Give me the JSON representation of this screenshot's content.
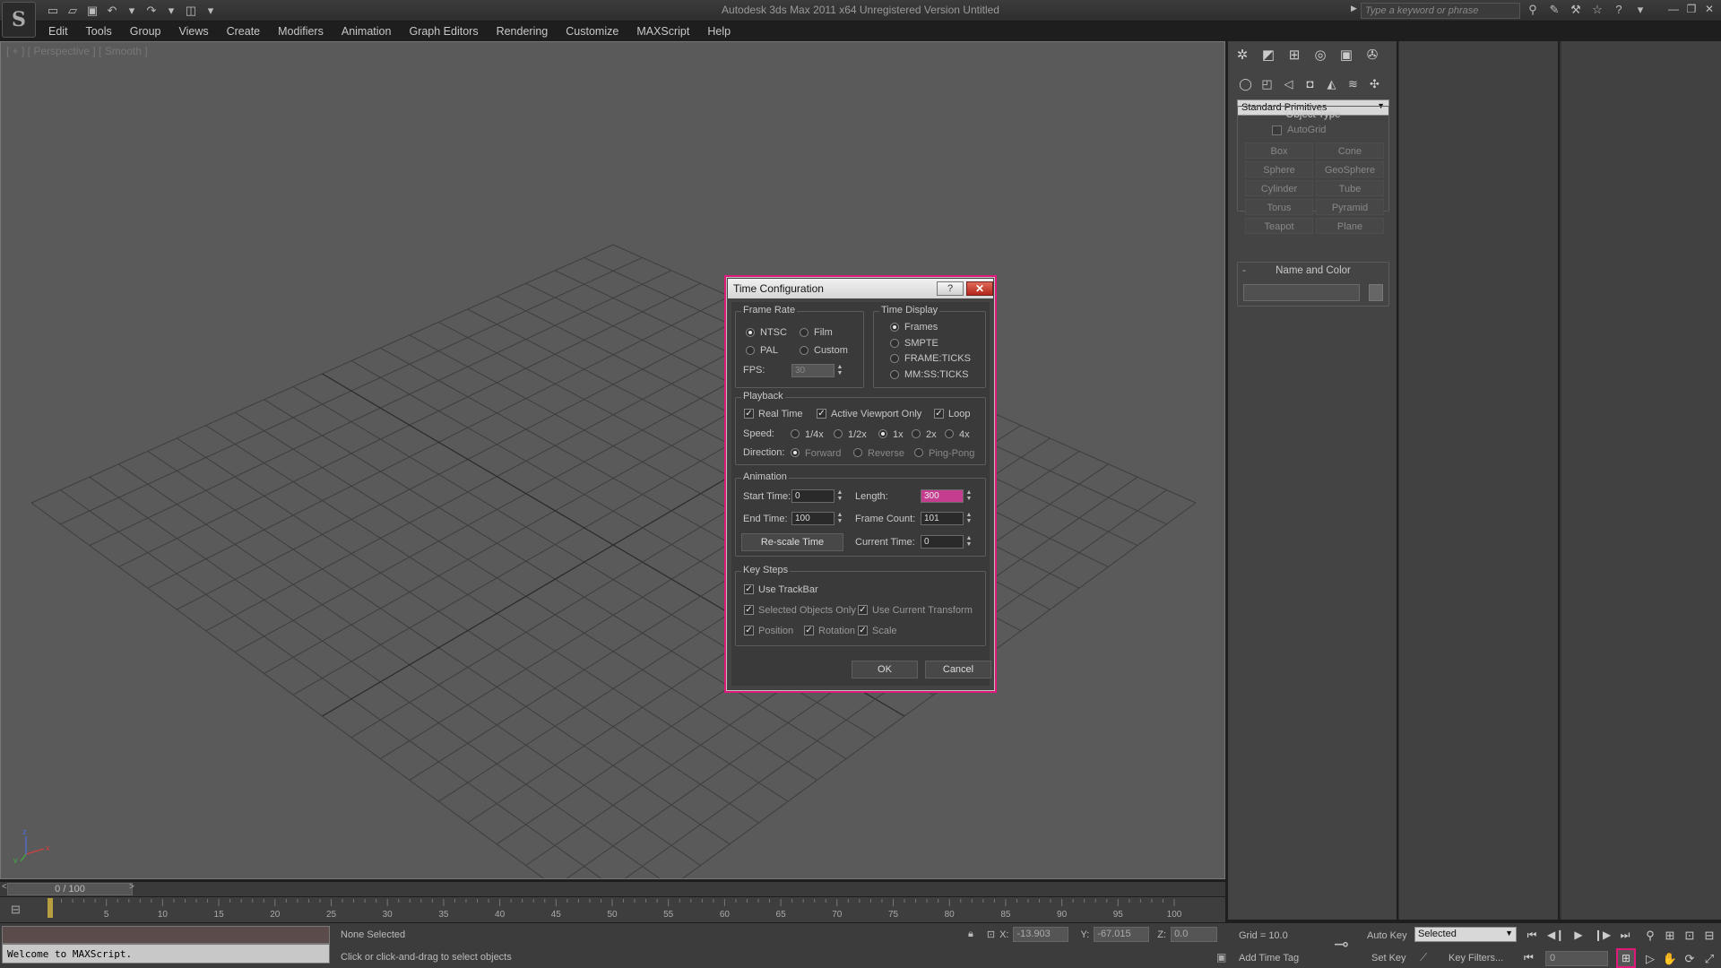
{
  "titlebar": {
    "title": "Autodesk 3ds Max  2011 x64    Unregistered Version    Untitled",
    "search_placeholder": "Type a keyword or phrase",
    "logo_glyph": "S"
  },
  "menu": [
    "Edit",
    "Tools",
    "Group",
    "Views",
    "Create",
    "Modifiers",
    "Animation",
    "Graph Editors",
    "Rendering",
    "Customize",
    "MAXScript",
    "Help"
  ],
  "viewport": {
    "label": "[ + ] [ Perspective ] [ Smooth ]",
    "axis": {
      "x": "x",
      "y": "y",
      "z": "z"
    }
  },
  "command_panel": {
    "dropdown": "Standard Primitives",
    "object_type_title": "Object Type",
    "autogrid_label": "AutoGrid",
    "primitives": [
      "Box",
      "Cone",
      "Sphere",
      "GeoSphere",
      "Cylinder",
      "Tube",
      "Torus",
      "Pyramid",
      "Teapot",
      "Plane"
    ],
    "name_color_title": "Name and Color"
  },
  "timeline": {
    "slider_label": "0 / 100",
    "ticks": [
      "5",
      "10",
      "15",
      "20",
      "25",
      "30",
      "35",
      "40",
      "45",
      "50",
      "55",
      "60",
      "65",
      "70",
      "75",
      "80",
      "85",
      "90",
      "95",
      "100"
    ]
  },
  "status": {
    "maxscript_output": "Welcome to MAXScript.",
    "selection": "None Selected",
    "prompt": "Click or click-and-drag to select objects",
    "x_label": "X:",
    "x_value": "-13.903",
    "y_label": "Y:",
    "y_value": "-67.015",
    "z_label": "Z:",
    "z_value": "0.0",
    "grid": "Grid = 10.0",
    "add_time_tag": "Add Time Tag",
    "auto_key": "Auto Key",
    "set_key": "Set Key",
    "key_mode": "Selected",
    "key_filters": "Key Filters...",
    "current_frame": "0"
  },
  "dialog": {
    "title": "Time Configuration",
    "help": "?",
    "close": "✕",
    "frame_rate": {
      "title": "Frame Rate",
      "ntsc": "NTSC",
      "film": "Film",
      "pal": "PAL",
      "custom": "Custom",
      "fps_label": "FPS:",
      "fps_value": "30"
    },
    "time_display": {
      "title": "Time Display",
      "options": [
        "Frames",
        "SMPTE",
        "FRAME:TICKS",
        "MM:SS:TICKS"
      ]
    },
    "playback": {
      "title": "Playback",
      "real_time": "Real Time",
      "active_viewport_only": "Active Viewport Only",
      "loop": "Loop",
      "speed_label": "Speed:",
      "speeds": [
        "1/4x",
        "1/2x",
        "1x",
        "2x",
        "4x"
      ],
      "direction_label": "Direction:",
      "directions": [
        "Forward",
        "Reverse",
        "Ping-Pong"
      ]
    },
    "animation": {
      "title": "Animation",
      "start_time_label": "Start Time:",
      "start_time": "0",
      "length_label": "Length:",
      "length": "300",
      "end_time_label": "End Time:",
      "end_time": "100",
      "frame_count_label": "Frame Count:",
      "frame_count": "101",
      "rescale_button": "Re-scale Time",
      "current_time_label": "Current Time:",
      "current_time": "0"
    },
    "key_steps": {
      "title": "Key Steps",
      "use_trackbar": "Use TrackBar",
      "selected_objects_only": "Selected Objects Only",
      "use_current_transform": "Use Current Transform",
      "position": "Position",
      "rotation": "Rotation",
      "scale": "Scale"
    },
    "ok": "OK",
    "cancel": "Cancel"
  },
  "colors": {
    "accent": "#e0187a",
    "viewport_bg": "#5a5a5a",
    "ui_bg": "#3c3c3c"
  }
}
